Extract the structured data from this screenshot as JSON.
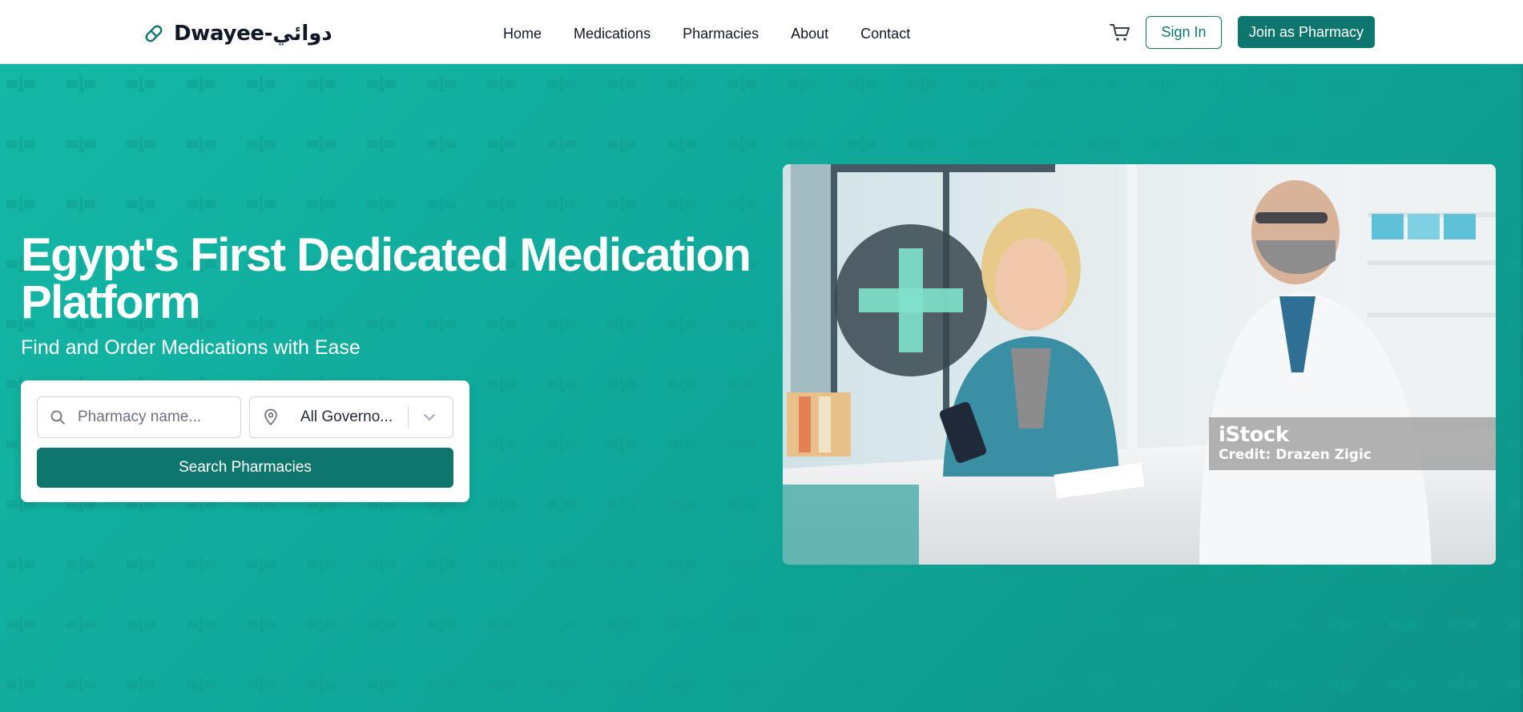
{
  "brand": {
    "name": "Dwayee-دوائي",
    "icon": "pill-icon",
    "accent_color": "#0f766e"
  },
  "nav": {
    "items": [
      {
        "label": "Home"
      },
      {
        "label": "Medications"
      },
      {
        "label": "Pharmacies"
      },
      {
        "label": "About"
      },
      {
        "label": "Contact"
      }
    ]
  },
  "header_actions": {
    "cart_icon": "cart-icon",
    "sign_in_label": "Sign In",
    "join_label": "Join as Pharmacy"
  },
  "hero": {
    "title": "Egypt's First Dedicated Medication Platform",
    "subtitle": "Find and Order Medications with Ease",
    "background_color": "#14b8a6",
    "search": {
      "name_placeholder": "Pharmacy name...",
      "name_icon": "search-icon",
      "governorate_icon": "location-pin-icon",
      "governorate_value": "All Governo...",
      "governorate_chevron": "chevron-down-icon",
      "button_label": "Search Pharmacies"
    },
    "image": {
      "credit_logo": "iStock",
      "credit_text": "Credit: Drazen Zigic"
    }
  }
}
